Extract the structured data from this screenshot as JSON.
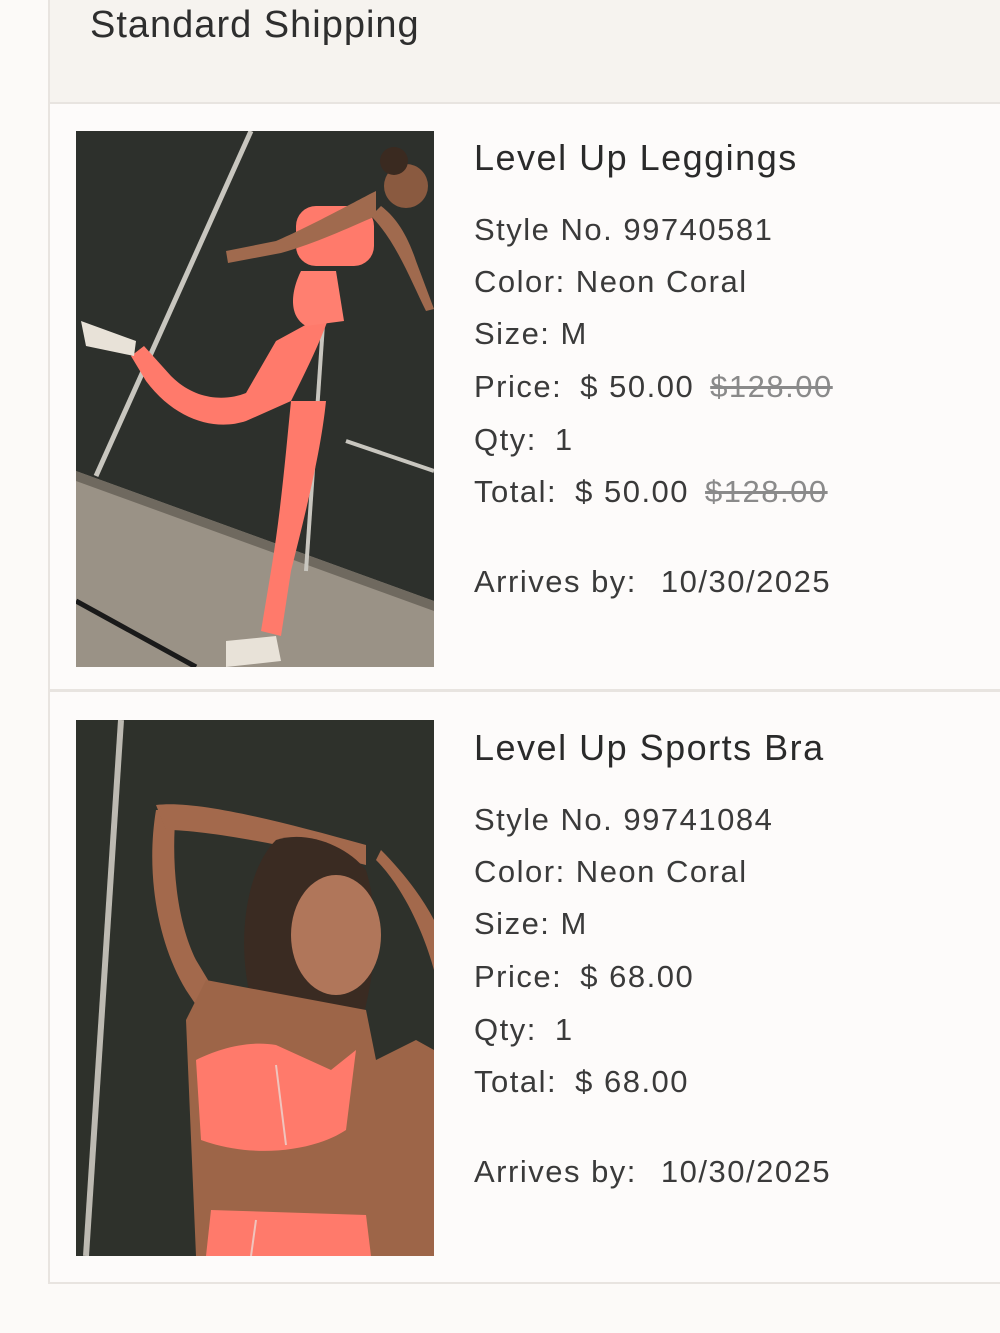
{
  "shipping": {
    "title": "Standard Shipping"
  },
  "items": [
    {
      "name": "Level Up Leggings",
      "style": "Style No. 99740581",
      "color": "Color: Neon Coral",
      "size": "Size: M",
      "price_label": "Price:",
      "price": "$ 50.00",
      "price_original": "$128.00",
      "qty_label": "Qty:",
      "qty": "1",
      "total_label": "Total:",
      "total": "$ 50.00",
      "total_original": "$128.00",
      "arrives_label": "Arrives by:",
      "arrives": "10/30/2025"
    },
    {
      "name": "Level Up Sports Bra",
      "style": "Style No. 99741084",
      "color": "Color: Neon Coral",
      "size": "Size: M",
      "price_label": "Price:",
      "price": "$ 68.00",
      "qty_label": "Qty:",
      "qty": "1",
      "total_label": "Total:",
      "total": "$ 68.00",
      "arrives_label": "Arrives by:",
      "arrives": "10/30/2025"
    }
  ],
  "colors": {
    "accent_coral": "#ff7a6b",
    "background": "#fcfaf8",
    "header_bg": "#f6f3ef"
  }
}
